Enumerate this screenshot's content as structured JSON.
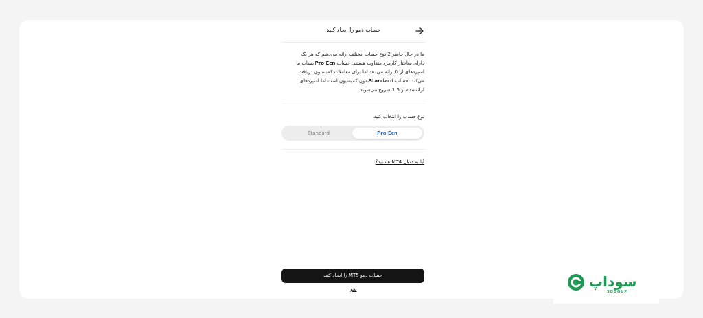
{
  "header": {
    "title": "حساب دمو را ایجاد کنید",
    "back_icon": "arrow-right-icon"
  },
  "description": {
    "line1": "ما در حال حاضر 2 نوع حساب مختلف ارائه می‌دهیم که هر یک",
    "line2_before": "دارای ساختار کارمزد متفاوت هستند. حساب ",
    "line2_bold": "Pro Ecn",
    "line2_after": "حساب ما",
    "line3": "اسپردهای از 0 ارائه می‌دهد اما برای معاملات کمیسیون دریافت",
    "line4_before": "می‌کند. حساب ",
    "line4_bold": "Standard",
    "line4_after": "بدون کمیسیون است اما اسپردهای",
    "line5": "ارائه‌شده از 1.5 شروع می‌شوند."
  },
  "account_type": {
    "label": "نوع حساب را انتخاب کنید",
    "options": [
      "Pro Ecn",
      "Standard"
    ],
    "selected": "Pro Ecn"
  },
  "mt4_link": "آیا به دنبال MT4 هستید؟",
  "create_button": "حساب دمو MT5 را ایجاد کنید",
  "cancel_link": "لغو",
  "watermark": {
    "text": "سوداپ",
    "sub": "SODOUP",
    "color": "#1f9a55"
  },
  "colors": {
    "accent": "#2b6fd6",
    "button": "#141414"
  }
}
